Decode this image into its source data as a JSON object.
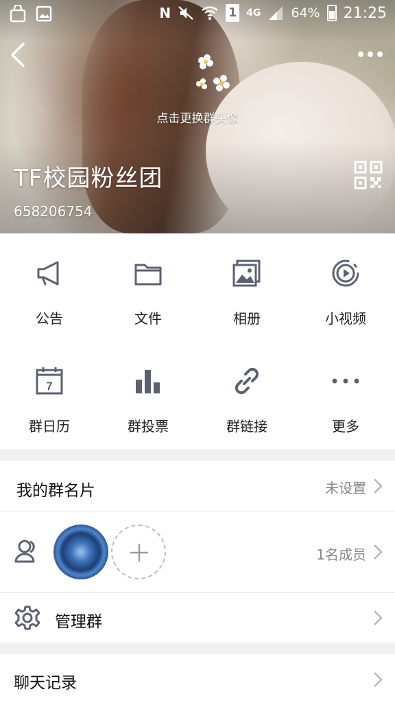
{
  "status_bar": {
    "network": "4G",
    "battery": "64%",
    "time": "21:25",
    "sim_slot": "1"
  },
  "header": {
    "change_avatar_hint": "点击更换群头像",
    "group_name": "TF校园粉丝团",
    "group_id": "658206754"
  },
  "features": [
    {
      "label": "公告",
      "icon": "megaphone-icon"
    },
    {
      "label": "文件",
      "icon": "folder-icon"
    },
    {
      "label": "相册",
      "icon": "photo-album-icon"
    },
    {
      "label": "小视频",
      "icon": "video-icon"
    },
    {
      "label": "群日历",
      "icon": "calendar-icon"
    },
    {
      "label": "群投票",
      "icon": "bar-chart-icon"
    },
    {
      "label": "群链接",
      "icon": "link-icon"
    },
    {
      "label": "更多",
      "icon": "more-dots-icon"
    }
  ],
  "calendar_day": "7",
  "my_card": {
    "title": "我的群名片",
    "value": "未设置"
  },
  "members": {
    "count_text": "1名成员"
  },
  "manage": {
    "title": "管理群"
  },
  "chat_history": {
    "title": "聊天记录"
  },
  "colors": {
    "icon_gray": "#5b6170",
    "text": "#222222",
    "secondary": "#888888"
  }
}
